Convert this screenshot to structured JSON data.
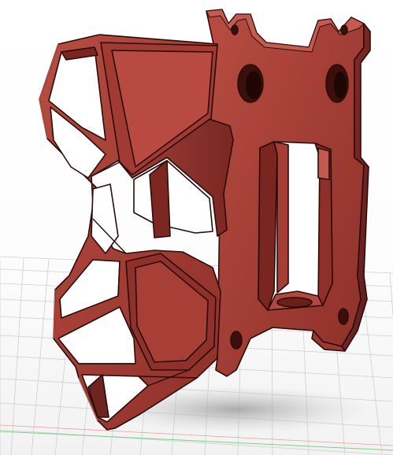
{
  "viewport": {
    "kind": "3d-cad-model-viewport",
    "background": "#ffffff",
    "grid_color": "#c8c8c8",
    "x_axis_color": "#e06a6a",
    "y_axis_color": "#4fb95a"
  },
  "model": {
    "description_icon": "3d-printed-geometric-frame",
    "body_color": "#9c3a33",
    "face_highlight": "#b64a40",
    "face_shadow": "#6e2420",
    "edge_color": "#2a0c0a",
    "shadow_color": "#bdbdbd"
  }
}
